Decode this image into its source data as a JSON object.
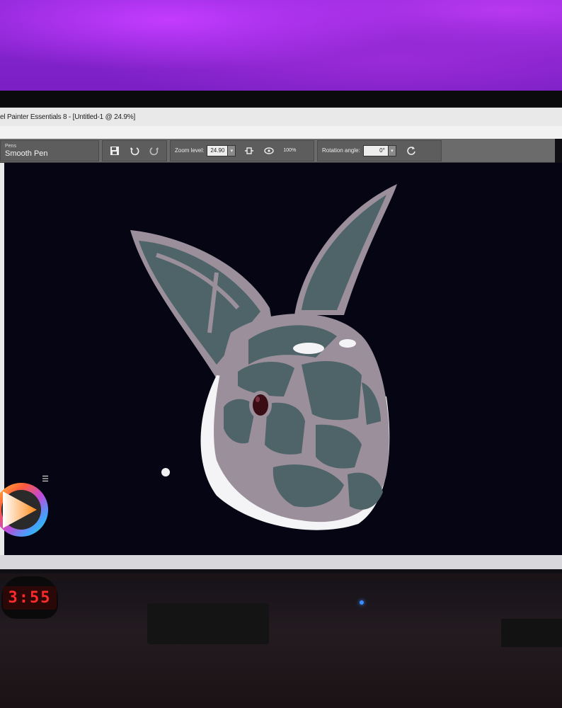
{
  "window": {
    "title": "el Painter Essentials 8 - [Untitled-1 @ 24.9%]"
  },
  "toolbar": {
    "brush_category": "Pens",
    "brush_name": "Smooth Pen",
    "zoom_label": "Zoom level:",
    "zoom_value": "24.90",
    "zoom_percent": "100%",
    "rotation_label": "Rotation angle:",
    "rotation_value": "0°",
    "icons": [
      "save-icon",
      "undo-icon",
      "redo-icon",
      "fit-screen-icon",
      "actual-size-icon",
      "reset-rotation-icon"
    ]
  },
  "canvas": {
    "background_color": "#050514",
    "subject": "rabbit-head-illustration"
  },
  "desk": {
    "clock_time": "3:55"
  },
  "colors": {
    "wall": "#8a26d4",
    "rabbit_fill": "#4e6468",
    "rabbit_outline": "#9a8f9a",
    "rabbit_white": "#f4f4f6",
    "clock_digits": "#ff2a2a"
  }
}
